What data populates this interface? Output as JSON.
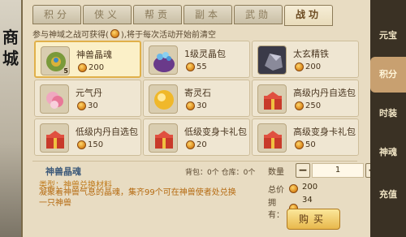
{
  "shop": {
    "char_top": "商",
    "char_bottom": "城"
  },
  "tabs": [
    {
      "label": "积分"
    },
    {
      "label": "侠义"
    },
    {
      "label": "帮贡"
    },
    {
      "label": "副本"
    },
    {
      "label": "武勋"
    },
    {
      "label": "战功"
    }
  ],
  "active_tab": "战功",
  "notice": {
    "prefix": "参与神域之战可获得(",
    "suffix": "),将于每次活动开始前清空"
  },
  "items": [
    {
      "name": "神兽晶魂",
      "price": "200",
      "badge": "5",
      "icon": "beast-crystal-icon",
      "color": "#6a8a3a"
    },
    {
      "name": "1级灵晶包",
      "price": "55",
      "badge": "",
      "icon": "spirit-crystal-bag-icon",
      "color": "#7a4a9a"
    },
    {
      "name": "太玄精铁",
      "price": "200",
      "badge": "",
      "icon": "iron-ore-icon",
      "color": "#6a6a78"
    },
    {
      "name": "元气丹",
      "price": "30",
      "badge": "",
      "icon": "pill-icon",
      "color": "#e48aa8"
    },
    {
      "name": "寄灵石",
      "price": "30",
      "badge": "",
      "icon": "spirit-stone-icon",
      "color": "#e8b02a"
    },
    {
      "name": "高级内丹自选包",
      "price": "250",
      "badge": "",
      "icon": "gift-box-icon",
      "color": "#c83a2a"
    },
    {
      "name": "低级内丹自选包",
      "price": "150",
      "badge": "",
      "icon": "gift-box-icon",
      "color": "#c83a2a"
    },
    {
      "name": "低级变身卡礼包",
      "price": "20",
      "badge": "",
      "icon": "gift-box-icon",
      "color": "#c83a2a"
    },
    {
      "name": "高级变身卡礼包",
      "price": "50",
      "badge": "",
      "icon": "gift-box-icon",
      "color": "#c83a2a"
    }
  ],
  "detail": {
    "title": "神兽晶魂",
    "type": "类型：神兽兑换材料",
    "desc": "凝聚着神兽气息的晶魂，集齐99个可在神兽使者处兑换一只神兽",
    "bag": "背包：0个  仓库：0个"
  },
  "purchase": {
    "qty_label": "数量",
    "qty_value": "1",
    "minus": "−",
    "plus": "+",
    "total_label": "总价",
    "total_value": "200",
    "owned_label": "拥有：",
    "owned_value": "34",
    "buy_label": "购买"
  },
  "sidebar": [
    {
      "label": "元宝"
    },
    {
      "label": "积分"
    },
    {
      "label": "时装"
    },
    {
      "label": "神魂"
    },
    {
      "label": "充值"
    }
  ],
  "colors": {
    "accent": "#e0b04a",
    "panel": "#e8dcc2",
    "sidebar_active": "#c8a070"
  }
}
